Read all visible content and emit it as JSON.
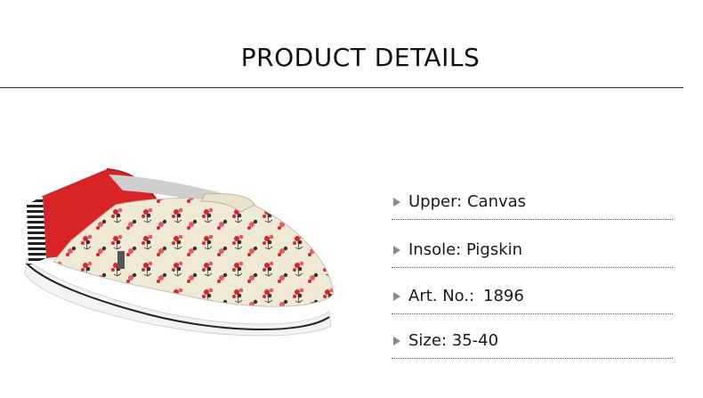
{
  "header": {
    "title": "PRODUCT DETAILS"
  },
  "product_image": {
    "description_icon": "shoe-image"
  },
  "details": [
    {
      "label": "Upper: Canvas",
      "value": ""
    },
    {
      "label": "Insole: Pigskin",
      "value": ""
    },
    {
      "label": "Art. No.:",
      "value": "1896"
    },
    {
      "label": "Size: 35-40",
      "value": ""
    }
  ],
  "colors": {
    "accent_red": "#d82327",
    "text": "#1a1a1a",
    "arrow": "#8a8a8a"
  }
}
